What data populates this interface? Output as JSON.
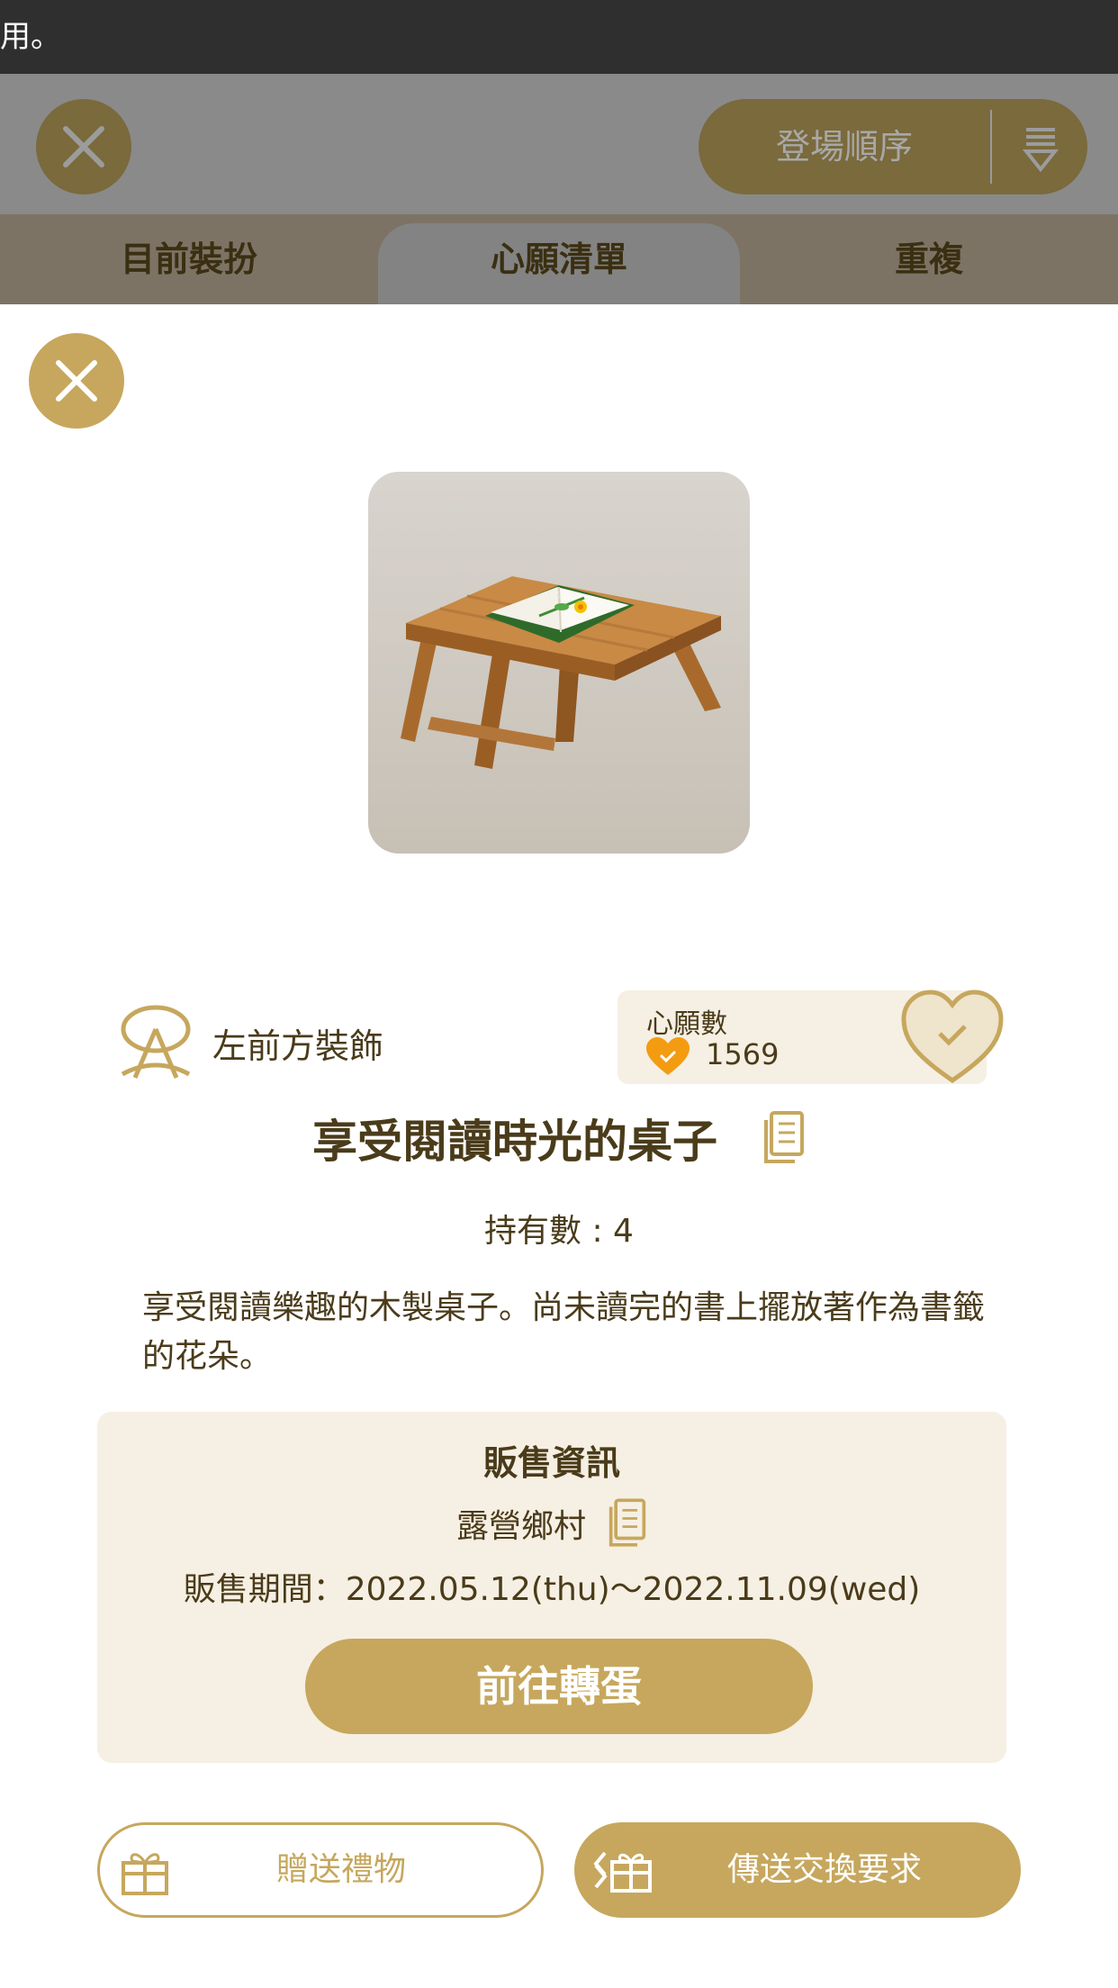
{
  "status_bar": {
    "text": "用。"
  },
  "header": {
    "sort_label": "登場順序"
  },
  "tabs": [
    {
      "label": "目前裝扮"
    },
    {
      "label": "心願清單"
    },
    {
      "label": "重複"
    }
  ],
  "item": {
    "slot_label": "左前方裝飾",
    "wish": {
      "title": "心願數",
      "count": "1569"
    },
    "name": "享受閱讀時光的桌子",
    "owned": "持有數 : 4",
    "description": "享受閱讀樂趣的木製桌子。尚未讀完的書上擺放著作為書籤的花朵。"
  },
  "sale": {
    "title": "販售資訊",
    "shop": "露營鄉村",
    "period": "販售期間：2022.05.12(thu)～2022.11.09(wed)",
    "gacha_button": "前往轉蛋"
  },
  "actions": {
    "gift_label": "贈送禮物",
    "trade_label": "傳送交換要求"
  },
  "colors": {
    "accent": "#c6a75d",
    "panel": "#f6efe3",
    "text": "#4a3b1a",
    "heart": "#f39c12"
  }
}
